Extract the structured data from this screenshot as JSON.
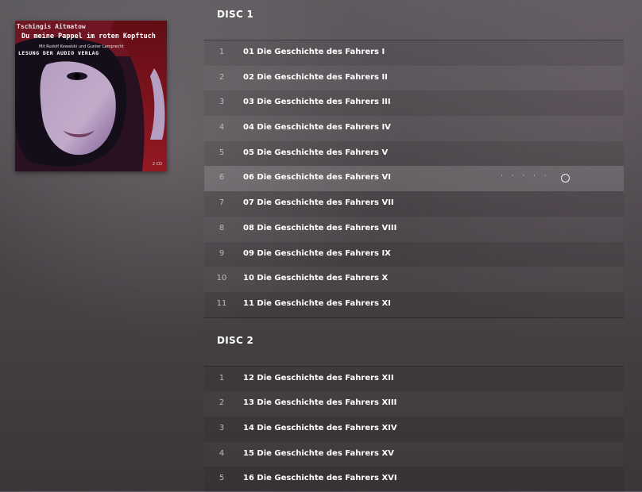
{
  "album": {
    "author_text": "Tschingis Aitmatow",
    "title_text": "Du meine Pappel im roten Kopftuch",
    "credit_text": "Mit Rudolf Kowalski und Gunter Lamprecht",
    "lesung_text": "LESUNG DER AUDIO VERLAG",
    "badge_text": "2 CD"
  },
  "discs": [
    {
      "label": "DISC 1",
      "tracks": [
        {
          "num": "1",
          "title": "01 Die Geschichte des Fahrers I"
        },
        {
          "num": "2",
          "title": "02 Die Geschichte des Fahrers II"
        },
        {
          "num": "3",
          "title": "03 Die Geschichte des Fahrers III"
        },
        {
          "num": "4",
          "title": "04 Die Geschichte des Fahrers IV"
        },
        {
          "num": "5",
          "title": "05 Die Geschichte des Fahrers V"
        },
        {
          "num": "6",
          "title": "06 Die Geschichte des Fahrers VI",
          "hovered": true,
          "dots": "· · · · ·"
        },
        {
          "num": "7",
          "title": "07 Die Geschichte des Fahrers VII"
        },
        {
          "num": "8",
          "title": "08 Die Geschichte des Fahrers VIII"
        },
        {
          "num": "9",
          "title": "09 Die Geschichte des Fahrers IX"
        },
        {
          "num": "10",
          "title": "10 Die Geschichte des Fahrers X"
        },
        {
          "num": "11",
          "title": "11 Die Geschichte des Fahrers XI"
        }
      ]
    },
    {
      "label": "DISC 2",
      "tracks": [
        {
          "num": "1",
          "title": "12 Die Geschichte des Fahrers XII"
        },
        {
          "num": "2",
          "title": "13 Die Geschichte des Fahrers XIII"
        },
        {
          "num": "3",
          "title": "14 Die Geschichte des Fahrers XIV"
        },
        {
          "num": "4",
          "title": "15 Die Geschichte des Fahrers XV"
        },
        {
          "num": "5",
          "title": "16 Die Geschichte des Fahrers XVI"
        }
      ]
    }
  ],
  "colors": {
    "background": "#4a4549",
    "text": "#ffffff",
    "track_number": "#bdb8bc",
    "art_red": "#8e1a1e"
  },
  "icons": {
    "row_more": "more-dots-icon",
    "row_circle": "circle-icon"
  }
}
